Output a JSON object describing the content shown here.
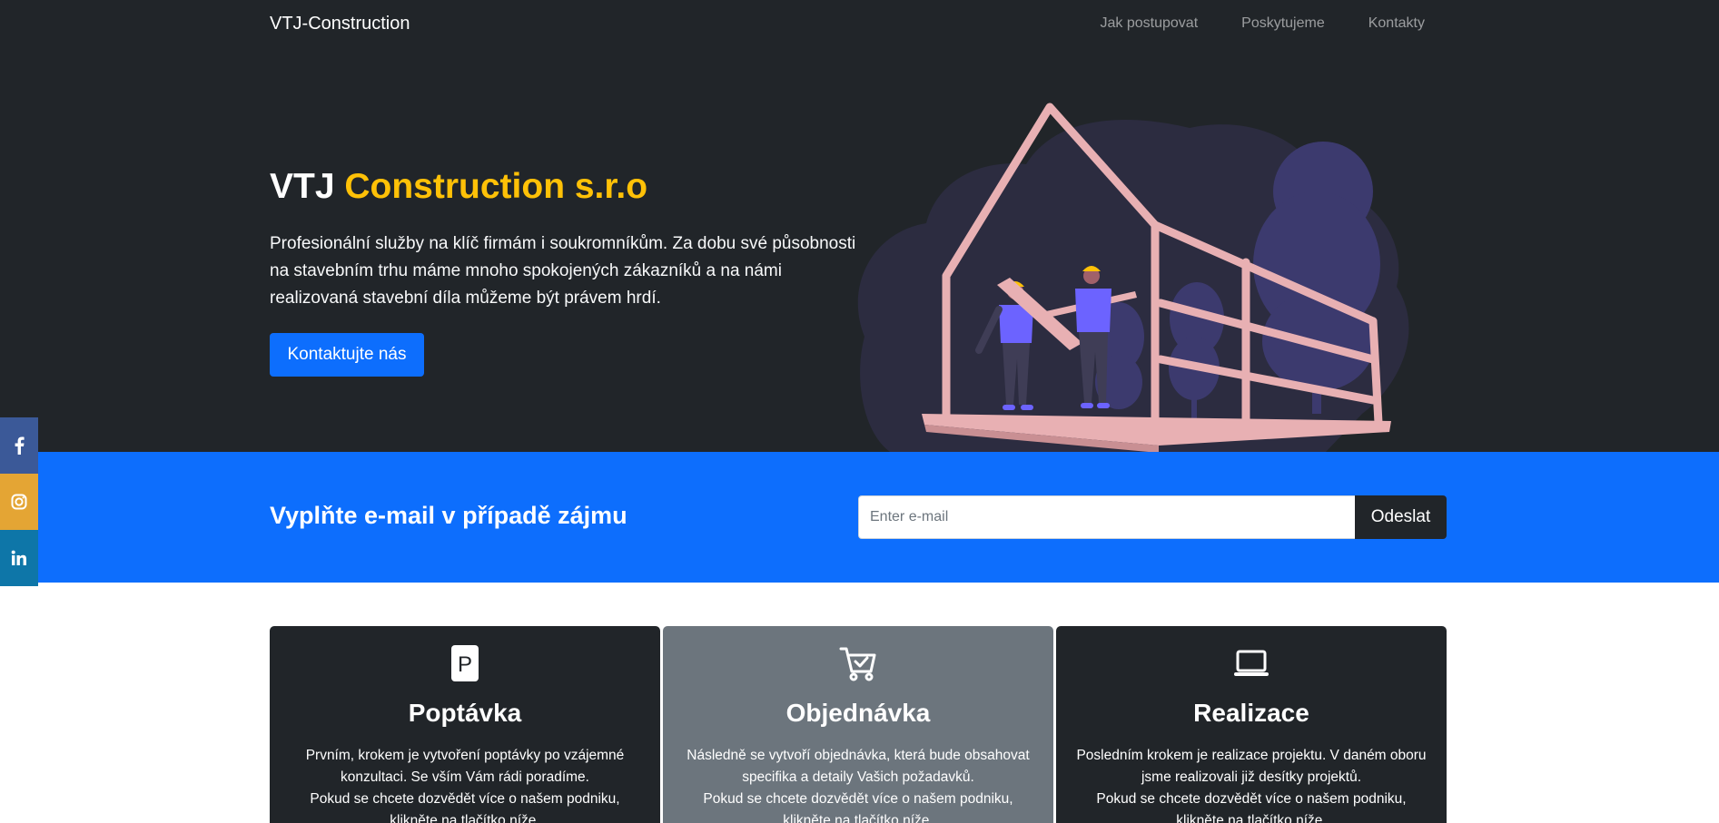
{
  "navbar": {
    "brand": "VTJ-Construction",
    "links": [
      "Jak postupovat",
      "Poskytujeme",
      "Kontakty"
    ]
  },
  "hero": {
    "title_main": "VTJ",
    "title_accent": "Construction s.r.o",
    "text": "Profesionální služby na klíč firmám i soukromníkům. Za dobu své působnosti na stavebním trhu máme mnoho spokojených zákazníků a na námi realizovaná stavební díla můžeme být právem hrdí.",
    "button_label": "Kontaktujte nás",
    "illustration": "construction-workers-illustration"
  },
  "email_band": {
    "heading": "Vyplňte e-mail v případě zájmu",
    "input_placeholder": "Enter e-mail",
    "input_value": "",
    "button_label": "Odeslat"
  },
  "social": [
    {
      "name": "facebook-icon",
      "label": "f"
    },
    {
      "name": "instagram-icon",
      "label": "instagram"
    },
    {
      "name": "linkedin-icon",
      "label": "in"
    }
  ],
  "cards": [
    {
      "icon": "parking-icon",
      "icon_letter": "P",
      "title": "Poptávka",
      "text_line1": "Prvním, krokem je vytvoření poptávky po vzájemné konzultaci. Se vším Vám rádi poradíme.",
      "text_line2": "Pokud se chcete dozvědět více o našem podniku, klikněte na tlačítko níže."
    },
    {
      "icon": "cart-check-icon",
      "title": "Objednávka",
      "text_line1": "Následně se vytvoří objednávka, která bude obsahovat specifika a detaily Vašich požadavků.",
      "text_line2": "Pokud se chcete dozvědět více o našem podniku, klikněte na tlačítko níže."
    },
    {
      "icon": "laptop-icon",
      "title": "Realizace",
      "text_line1": "Posledním krokem je realizace projektu. V daném oboru jsme realizovali již desítky projektů.",
      "text_line2": "Pokud se chcete dozvědět více o našem podniku, klikněte na tlačítko níže."
    }
  ],
  "colors": {
    "dark": "#212529",
    "primary": "#0d6efd",
    "accent": "#ffc107",
    "secondary": "#6c757d",
    "facebook": "#3b5998",
    "instagram": "#e4a534",
    "linkedin": "#0e76a8"
  }
}
